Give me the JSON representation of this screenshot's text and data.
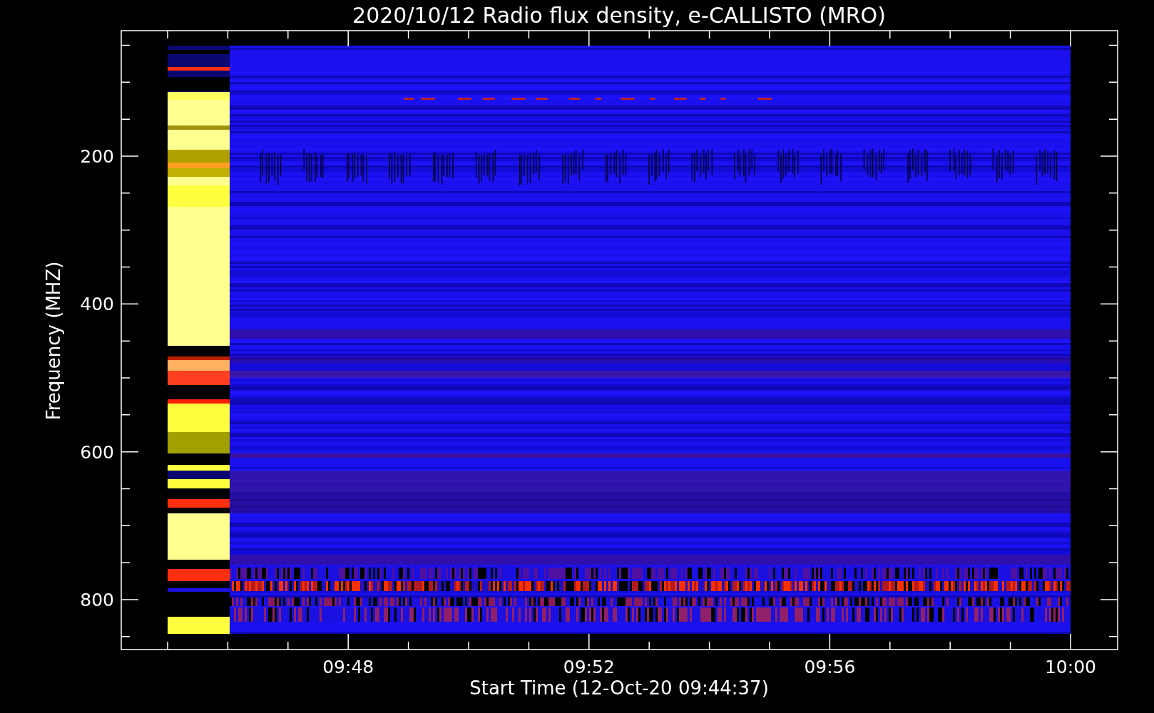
{
  "title": "2020/10/12  Radio flux density, e-CALLISTO (MRO)",
  "y_axis": {
    "label": "Frequency (MHZ)",
    "ticks": [
      "200",
      "400",
      "600",
      "800"
    ]
  },
  "x_axis": {
    "label": "Start Time (12-Oct-20 09:44:37)",
    "ticks": [
      "09:48",
      "09:52",
      "09:56",
      "10:00"
    ]
  }
}
